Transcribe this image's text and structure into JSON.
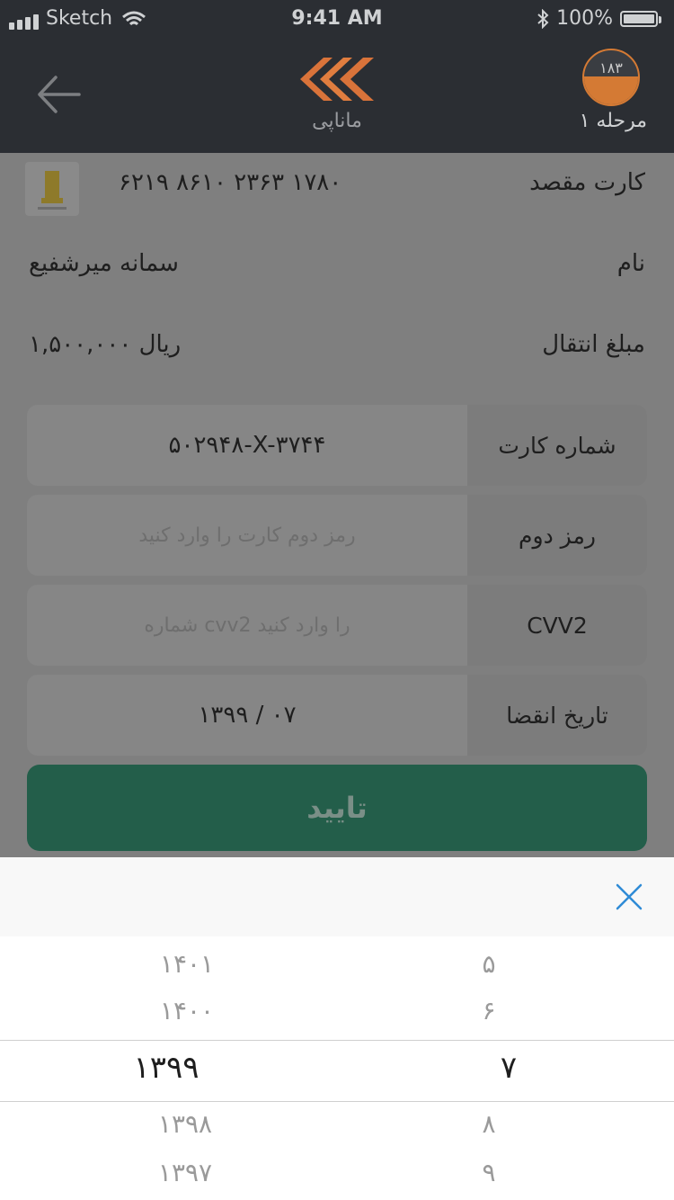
{
  "status_bar": {
    "carrier": "Sketch",
    "time": "9:41 AM",
    "battery": "100%"
  },
  "header": {
    "logo_text": "ماناپی",
    "step_number": "۱۸۳",
    "step_label": "مرحله ۱",
    "colors": {
      "bar": "#2b2e33",
      "accent": "#d47a34"
    }
  },
  "transfer": {
    "dest_card_label": "کارت مقصد",
    "dest_card_number": "۶۲۱۹ ۸۶۱۰ ۲۳۶۳ ۱۷۸۰",
    "name_label": "نام",
    "name_value": "سمانه میرشفیع",
    "amount_label": "مبلغ انتقال",
    "amount_value": "۱,۵۰۰,۰۰۰ ریال"
  },
  "form": {
    "card_number_label": "شماره کارت",
    "card_number_value": "۵۰۲۹۴۸-X-۳۷۴۴",
    "pin2_label": "رمز دوم",
    "pin2_placeholder": "رمز دوم کارت را وارد کنید",
    "cvv2_label": "CVV2",
    "cvv2_placeholder": "شماره cvv2 را وارد کنید",
    "expiry_label": "تاریخ انقضا",
    "expiry_value": "۱۳۹۹ / ۰۷",
    "confirm_label": "تایید",
    "confirm_color": "#235e4a"
  },
  "picker": {
    "years": [
      "۱۴۰۱",
      "۱۴۰۰",
      "۱۳۹۹",
      "۱۳۹۸",
      "۱۳۹۷"
    ],
    "months": [
      "۵",
      "۶",
      "۷",
      "۸",
      "۹"
    ],
    "selected_year": "۱۳۹۹",
    "selected_month": "۷"
  }
}
